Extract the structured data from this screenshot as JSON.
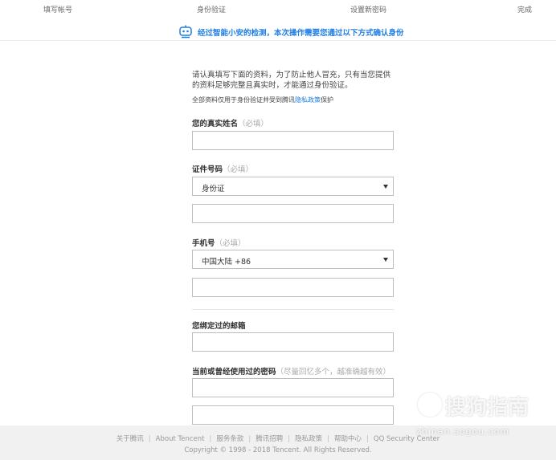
{
  "steps": [
    "填写帐号",
    "身份验证",
    "设置新密码",
    "完成"
  ],
  "notice": {
    "icon": "robot-shield-icon",
    "text": "经过智能小安的检测，本次操作需要您通过以下方式确认身份",
    "color": "#1d7ee4"
  },
  "intro": {
    "text": "请认真填写下面的资料，为了防止他人冒充，只有当您提供的资料足够完整且真实时，才能通过身份验证。",
    "note_prefix": "全部资料仅用于身份验证并受到腾讯",
    "note_link": "隐私政策",
    "note_suffix": "保护"
  },
  "fields": {
    "real_name": {
      "label": "您的真实姓名",
      "hint": "（必填）"
    },
    "id_number": {
      "label": "证件号码",
      "hint": "（必填）",
      "type_value": "身份证"
    },
    "phone": {
      "label": "手机号",
      "hint": "（必填）",
      "region_value": "中国大陆 +86"
    },
    "email": {
      "label": "您绑定过的邮箱",
      "hint": ""
    },
    "password": {
      "label": "当前或曾经使用过的密码",
      "hint": "（尽量回忆多个，越准确越有效）"
    }
  },
  "footer": {
    "links": [
      "关于腾讯",
      "About Tencent",
      "服务条款",
      "腾讯招聘",
      "隐私政策",
      "帮助中心",
      "QQ Security Center"
    ],
    "separator": "|",
    "copyright": "Copyright © 1998 - 2018 Tencent. All Rights Reserved."
  },
  "watermark": {
    "brand": "搜狗指南",
    "url": "zhinan.sogou.com"
  }
}
